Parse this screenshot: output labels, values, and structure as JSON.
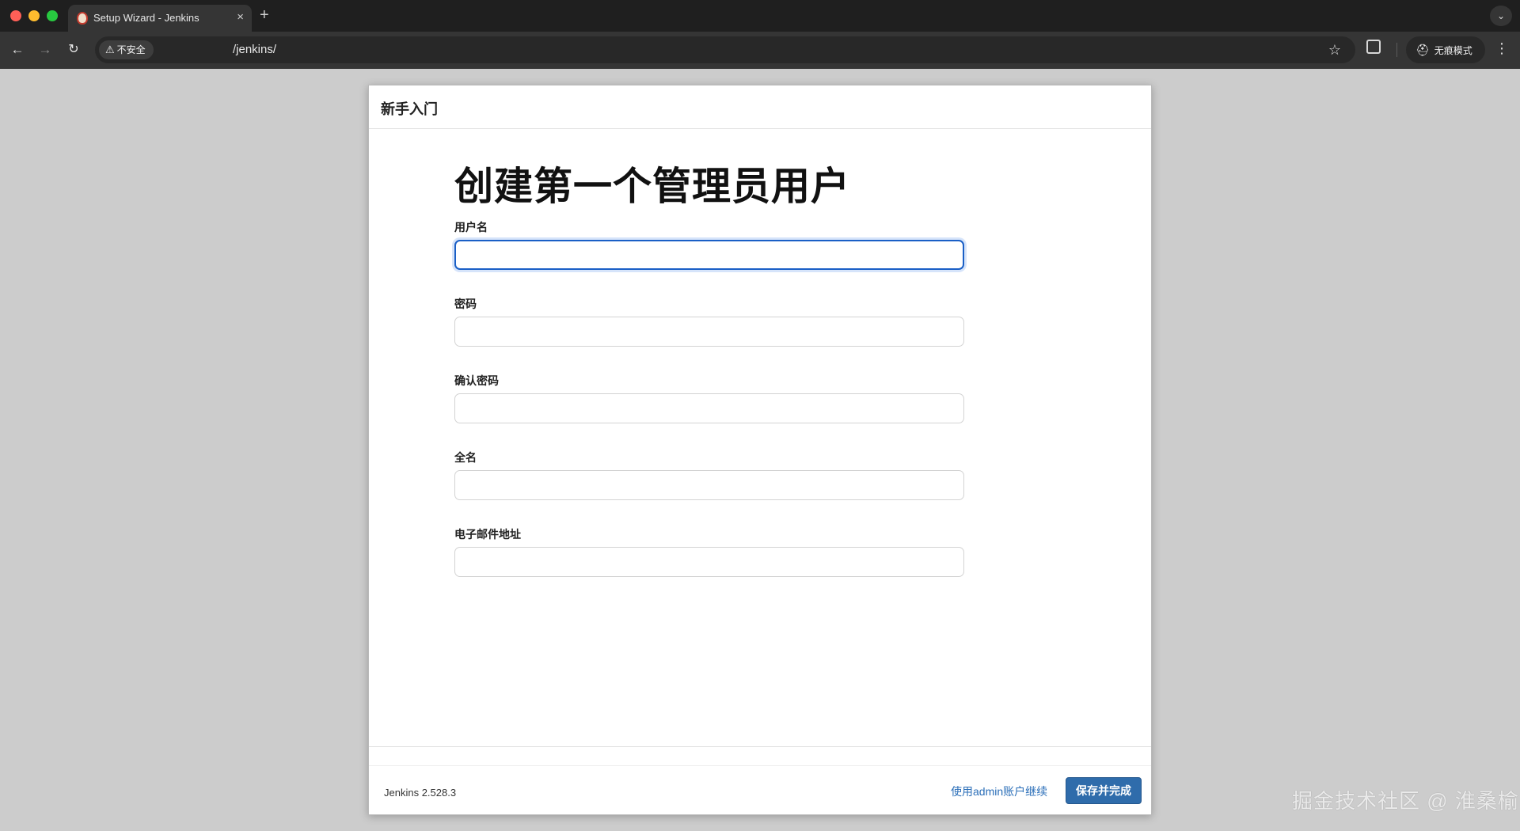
{
  "browser": {
    "tab_title": "Setup Wizard - Jenkins",
    "tab_close": "×",
    "new_tab": "+",
    "tab_dropdown": "⌄",
    "security_label": "不安全",
    "security_icon": "⚠",
    "url": "/jenkins/",
    "incognito_label": "无痕模式",
    "incognito_icon": "⛑",
    "nav_back": "←",
    "nav_forward": "→",
    "nav_reload": "↻",
    "star": "☆",
    "menu": "⋮"
  },
  "dialog": {
    "title": "新手入门",
    "heading": "创建第一个管理员用户",
    "fields": [
      {
        "label": "用户名",
        "value": ""
      },
      {
        "label": "密码",
        "value": ""
      },
      {
        "label": "确认密码",
        "value": ""
      },
      {
        "label": "全名",
        "value": ""
      },
      {
        "label": "电子邮件地址",
        "value": ""
      }
    ],
    "version": "Jenkins 2.528.3",
    "continue_link": "使用admin账户继续",
    "save_button": "保存并完成"
  },
  "watermark": "掘金技术社区 @ 淮桑榆",
  "colors": {
    "primary_button": "#2f6cab",
    "link": "#2a6eb8",
    "focus_ring": "#1a5fc6"
  }
}
